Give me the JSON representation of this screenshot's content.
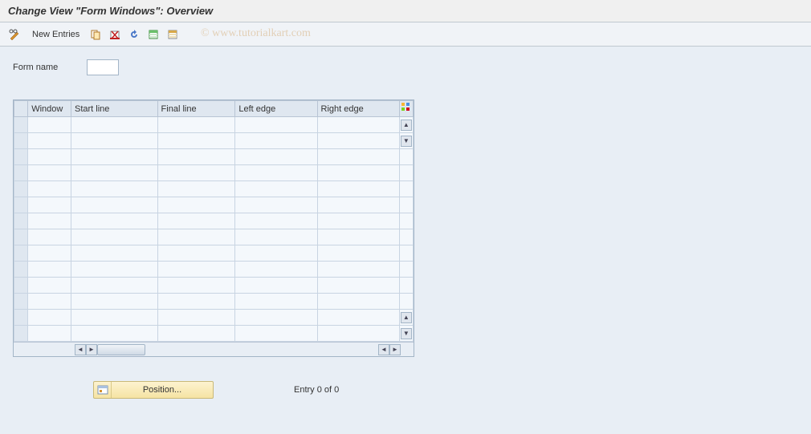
{
  "title": "Change View \"Form Windows\": Overview",
  "toolbar": {
    "new_entries_label": "New Entries"
  },
  "watermark": "© www.tutorialkart.com",
  "form": {
    "name_label": "Form name",
    "name_value": ""
  },
  "table": {
    "columns": [
      "Window",
      "Start line",
      "Final line",
      "Left edge",
      "Right edge"
    ],
    "rows": 14
  },
  "footer": {
    "position_label": "Position...",
    "entry_status": "Entry 0 of 0"
  }
}
